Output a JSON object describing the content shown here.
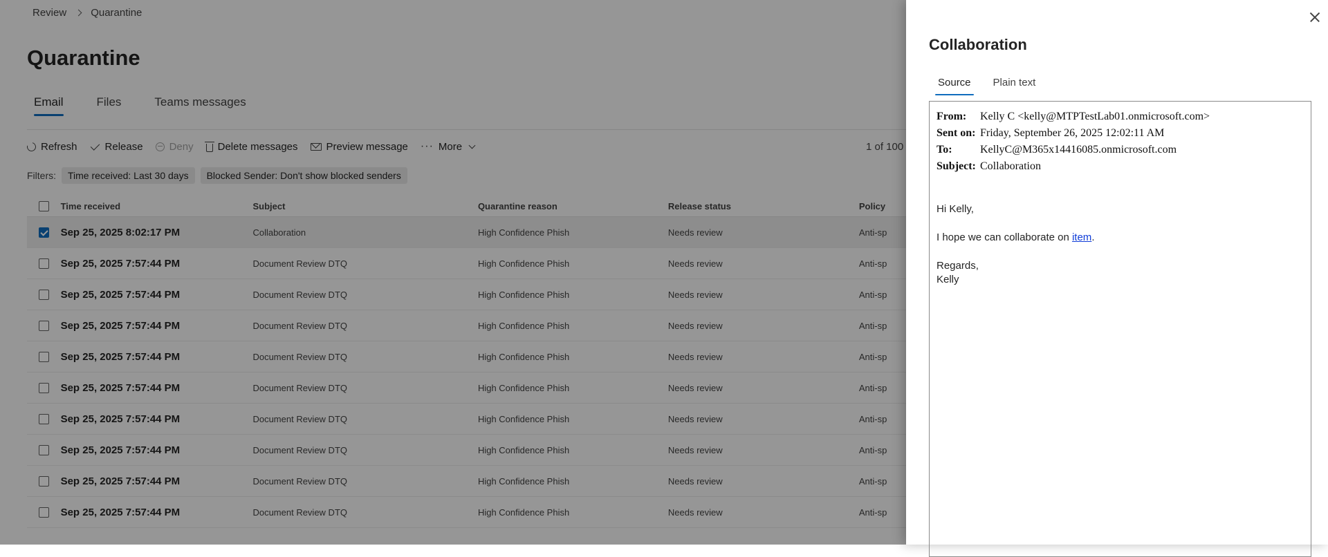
{
  "breadcrumb": {
    "items": [
      "Review",
      "Quarantine"
    ]
  },
  "page": {
    "title": "Quarantine"
  },
  "tabs": [
    {
      "label": "Email",
      "active": true
    },
    {
      "label": "Files",
      "active": false
    },
    {
      "label": "Teams messages",
      "active": false
    }
  ],
  "toolbar": {
    "refresh": "Refresh",
    "release": "Release",
    "deny": "Deny",
    "delete": "Delete messages",
    "preview": "Preview message",
    "more": "More",
    "count": "1 of 100"
  },
  "filters": {
    "label": "Filters:",
    "chips": [
      "Time received: Last 30 days",
      "Blocked Sender: Don't show blocked senders"
    ]
  },
  "table": {
    "columns": [
      "Time received",
      "Subject",
      "Quarantine reason",
      "Release status",
      "Policy"
    ],
    "rows": [
      {
        "time": "Sep 25, 2025 8:02:17 PM",
        "subject": "Collaboration",
        "reason": "High Confidence Phish",
        "status": "Needs review",
        "policy": "Anti-sp",
        "selected": true
      },
      {
        "time": "Sep 25, 2025 7:57:44 PM",
        "subject": "Document Review DTQ",
        "reason": "High Confidence Phish",
        "status": "Needs review",
        "policy": "Anti-sp",
        "selected": false
      },
      {
        "time": "Sep 25, 2025 7:57:44 PM",
        "subject": "Document Review DTQ",
        "reason": "High Confidence Phish",
        "status": "Needs review",
        "policy": "Anti-sp",
        "selected": false
      },
      {
        "time": "Sep 25, 2025 7:57:44 PM",
        "subject": "Document Review DTQ",
        "reason": "High Confidence Phish",
        "status": "Needs review",
        "policy": "Anti-sp",
        "selected": false
      },
      {
        "time": "Sep 25, 2025 7:57:44 PM",
        "subject": "Document Review DTQ",
        "reason": "High Confidence Phish",
        "status": "Needs review",
        "policy": "Anti-sp",
        "selected": false
      },
      {
        "time": "Sep 25, 2025 7:57:44 PM",
        "subject": "Document Review DTQ",
        "reason": "High Confidence Phish",
        "status": "Needs review",
        "policy": "Anti-sp",
        "selected": false
      },
      {
        "time": "Sep 25, 2025 7:57:44 PM",
        "subject": "Document Review DTQ",
        "reason": "High Confidence Phish",
        "status": "Needs review",
        "policy": "Anti-sp",
        "selected": false
      },
      {
        "time": "Sep 25, 2025 7:57:44 PM",
        "subject": "Document Review DTQ",
        "reason": "High Confidence Phish",
        "status": "Needs review",
        "policy": "Anti-sp",
        "selected": false
      },
      {
        "time": "Sep 25, 2025 7:57:44 PM",
        "subject": "Document Review DTQ",
        "reason": "High Confidence Phish",
        "status": "Needs review",
        "policy": "Anti-sp",
        "selected": false
      },
      {
        "time": "Sep 25, 2025 7:57:44 PM",
        "subject": "Document Review DTQ",
        "reason": "High Confidence Phish",
        "status": "Needs review",
        "policy": "Anti-sp",
        "selected": false
      }
    ]
  },
  "panel": {
    "title": "Collaboration",
    "tabs": [
      {
        "label": "Source",
        "active": true
      },
      {
        "label": "Plain text",
        "active": false
      }
    ],
    "headers": {
      "from_label": "From:",
      "from": "Kelly C <kelly@MTPTestLab01.onmicrosoft.com>",
      "sent_label": "Sent on:",
      "sent": "Friday, September 26, 2025 12:02:11 AM",
      "to_label": "To:",
      "to": "KellyC@M365x14416085.onmicrosoft.com",
      "subject_label": "Subject:",
      "subject": "Collaboration"
    },
    "body": {
      "greeting": "Hi Kelly,",
      "line_prefix": "I hope we can collaborate on ",
      "link": "item",
      "line_suffix": ".",
      "closing": "Regards,",
      "signature": "Kelly"
    }
  },
  "colors": {
    "accent": "#0f6cbd",
    "overlay": "rgba(0,0,0,0.4)",
    "link": "#0f3cd8"
  }
}
